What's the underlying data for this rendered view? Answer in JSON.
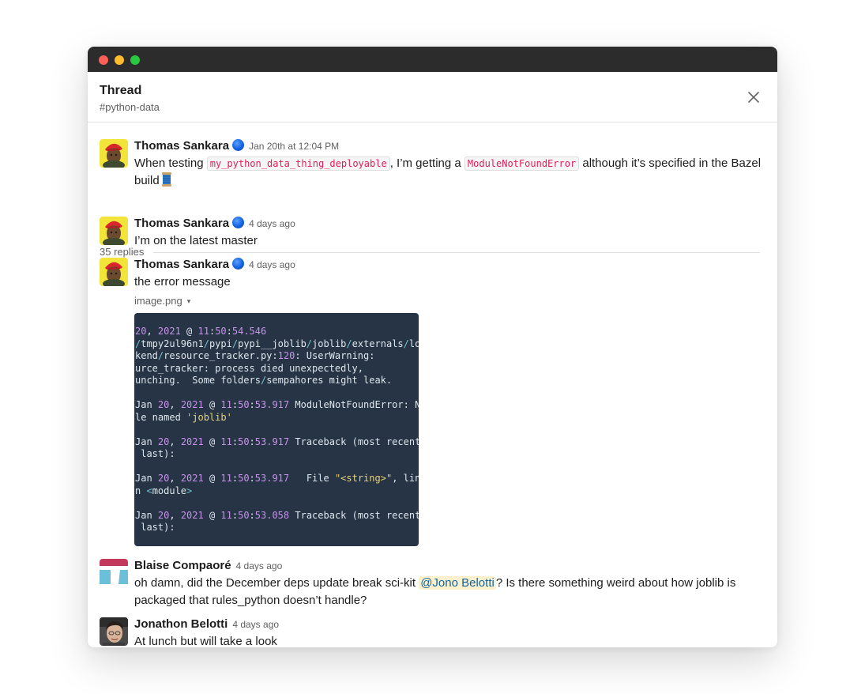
{
  "thread": {
    "title": "Thread",
    "channel": "#python-data"
  },
  "icons": {
    "close": "close-icon",
    "status": "blue-circle-icon",
    "spool": "spool-of-thread-icon",
    "caret": "caret-down-icon"
  },
  "colors": {
    "titlebar": "#2c2c2c",
    "code_text": "#e01e5a",
    "mention_bg": "#fdf0cc",
    "mention_text": "#1264a3",
    "image_bg": "#263445"
  },
  "parent": {
    "author": "Thomas Sankara",
    "time": "Jan 20th at 12:04 PM",
    "text_1": "When testing ",
    "code_1": "my_python_data_thing_deployable",
    "text_2": ", I’m getting a ",
    "code_2": "ModuleNotFoundError",
    "text_3": " although it’s specified in the Bazel build"
  },
  "replies_label": "35 replies",
  "messages": [
    {
      "author": "Thomas Sankara",
      "time": "4 days ago",
      "text": "I’m on the latest master"
    },
    {
      "author": "Thomas Sankara",
      "time": "4 days ago",
      "text": "the error message"
    },
    {
      "author": "Blaise Compaoré",
      "time": "4 days ago",
      "text_1": "oh damn, did the December deps update break sci-kit ",
      "mention": "@Jono Belotti",
      "text_2": "? Is there something weird about how joblib is packaged that rules_python doesn’t handle?"
    },
    {
      "author": "Jonathon Belotti",
      "time": "4 days ago",
      "text": "At lunch but will take a look"
    }
  ],
  "attachment": {
    "filename": "image.png",
    "caret": "▾",
    "lines": {
      "l1": {
        "n1": "20",
        "a": ", ",
        "n2": "2021",
        "b": " @ ",
        "n3": "11",
        "c": ":",
        "n4": "50",
        "d": ":",
        "n5": "54.546"
      },
      "l2": {
        "a": "tmpy2ul96n1",
        "b": "pypi",
        "c": "pypi__joblib",
        "d": "joblib",
        "e": "externals",
        "f": "lo"
      },
      "l3": {
        "a": "kend",
        "b": "resource_tracker.py:",
        "n": "120",
        "c": ": UserWarning:"
      },
      "l4": "urce_tracker: process died unexpectedly,",
      "l5": {
        "a": "unching.  Some folders",
        "b": "sempahores might leak."
      },
      "l6": {
        "a": "Jan ",
        "n1": "20",
        "b": ", ",
        "n2": "2021",
        "c": " @ ",
        "n3": "11",
        "d": ":",
        "n4": "50",
        "e": ":",
        "n5": "53.917",
        "f": " ModuleNotFoundError: N"
      },
      "l7": {
        "a": "le named ",
        "s": "'joblib'"
      },
      "l8": {
        "a": "Jan ",
        "n1": "20",
        "b": ", ",
        "n2": "2021",
        "c": " @ ",
        "n3": "11",
        "d": ":",
        "n4": "50",
        "e": ":",
        "n5": "53.917",
        "f": " Traceback (most recent"
      },
      "l9": " last):",
      "l10": {
        "a": "Jan ",
        "n1": "20",
        "b": ", ",
        "n2": "2021",
        "c": " @ ",
        "n3": "11",
        "d": ":",
        "n4": "50",
        "e": ":",
        "n5": "53.917",
        "f": "   File ",
        "s": "\"<string>\"",
        "g": ", lin"
      },
      "l11": {
        "a": "n ",
        "p1": "<",
        "b": "module",
        "p2": ">"
      },
      "l12": {
        "a": "Jan ",
        "n1": "20",
        "b": ", ",
        "n2": "2021",
        "c": " @ ",
        "n3": "11",
        "d": ":",
        "n4": "50",
        "e": ":",
        "n5": "53.058",
        "f": " Traceback (most recent"
      },
      "l13": " last):"
    }
  }
}
